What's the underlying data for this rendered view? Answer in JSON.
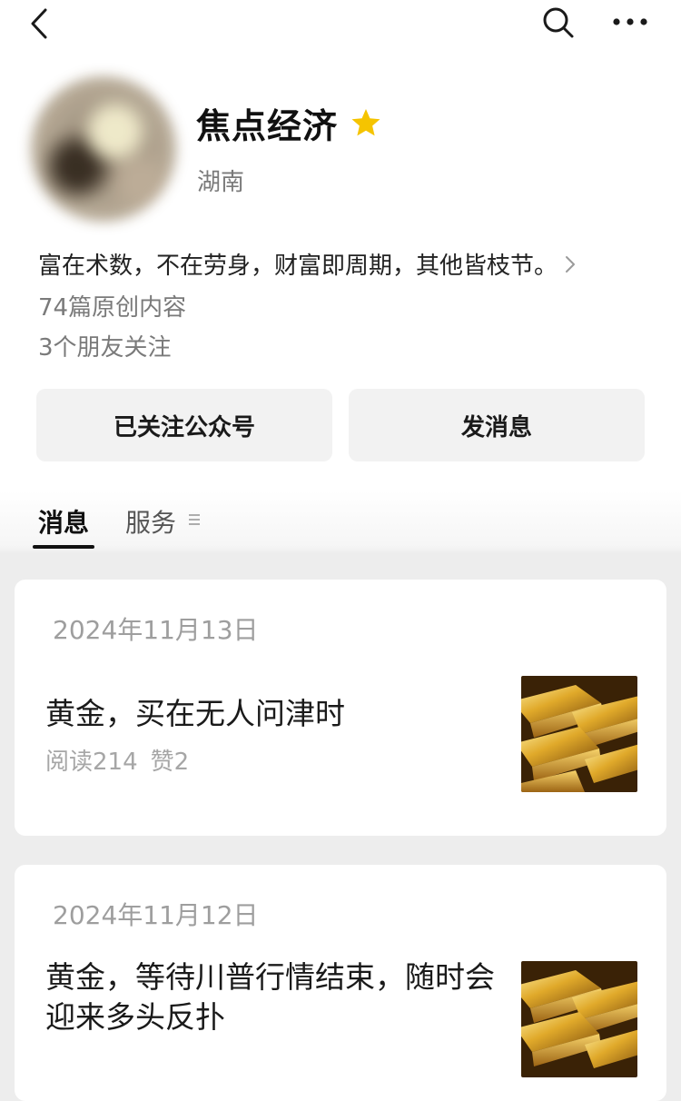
{
  "nav": {
    "back_icon": "chevron-left-icon",
    "search_icon": "search-icon",
    "more_icon": "more-horizontal-icon"
  },
  "profile": {
    "name": "焦点经济",
    "badge_icon": "star-icon",
    "badge_color": "#f5c400",
    "location": "湖南",
    "bio": "富在术数，不在劳身，财富即周期，其他皆枝节。",
    "original_count": "74篇原创内容",
    "friends_following": "3个朋友关注"
  },
  "actions": {
    "follow_label": "已关注公众号",
    "message_label": "发消息"
  },
  "tabs": [
    {
      "label": "消息",
      "active": true
    },
    {
      "label": "服务",
      "active": false
    }
  ],
  "articles": [
    {
      "date": "2024年11月13日",
      "title": "黄金，买在无人问津时",
      "reads": "阅读214",
      "likes": "赞2",
      "thumbnail": "gold-bars-image"
    },
    {
      "date": "2024年11月12日",
      "title": "黄金，等待川普行情结束，随时会迎来多头反扑",
      "thumbnail": "gold-bars-image"
    }
  ]
}
